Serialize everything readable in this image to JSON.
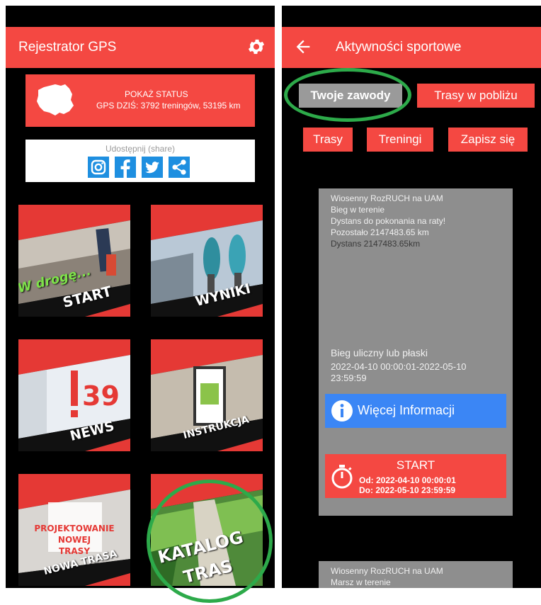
{
  "left_screen": {
    "app_title": "Rejestrator GPS",
    "status": {
      "line1": "POKAŻ STATUS",
      "line2": "GPS DZIŚ: 3792 treningów, 53195 km"
    },
    "share_label": "Udostępnij (share)",
    "tiles": [
      {
        "label": "START",
        "overlay": "W drogę..."
      },
      {
        "label": "WYNIKI"
      },
      {
        "label": "NEWS",
        "badge": "39"
      },
      {
        "label": "INSTRUKCJA"
      },
      {
        "label": "NOWA TRASA",
        "overlay_lines": [
          "PROJEKTOWANIE",
          "NOWEJ",
          "TRASY"
        ]
      },
      {
        "label_lines": [
          "KATALOG",
          "TRAS"
        ]
      }
    ]
  },
  "right_screen": {
    "app_title": "Aktywności sportowe",
    "buttons": {
      "twoje_zawody": "Twoje zawody",
      "trasy_w_poblizu": "Trasy w pobliżu",
      "trasy": "Trasy",
      "treningi": "Treningi",
      "zapisz_sie": "Zapisz się"
    },
    "card1": {
      "lines": [
        "Wiosenny RozRUCH na UAM",
        "Bieg w terenie",
        "Dystans do pokonania na raty!",
        "Pozostało 2147483.65 km",
        "Dystans 2147483.65km"
      ],
      "surface": "Bieg uliczny lub płaski",
      "dates_line1": "2022-04-10 00:00:01-2022-05-10",
      "dates_line2": "23:59:59",
      "info_button": "Więcej Informacji",
      "start_button": {
        "label": "START",
        "od": "Od: 2022-04-10 00:00:01",
        "do": "Do: 2022-05-10 23:59:59"
      }
    },
    "card2": {
      "lines": [
        "Wiosenny RozRUCH na UAM",
        "Marsz w terenie"
      ]
    }
  },
  "colors": {
    "accent_red": "#f44842",
    "info_blue": "#3b86f5",
    "card_gray": "#8e8e8e",
    "highlight_green": "#2daa4a"
  }
}
